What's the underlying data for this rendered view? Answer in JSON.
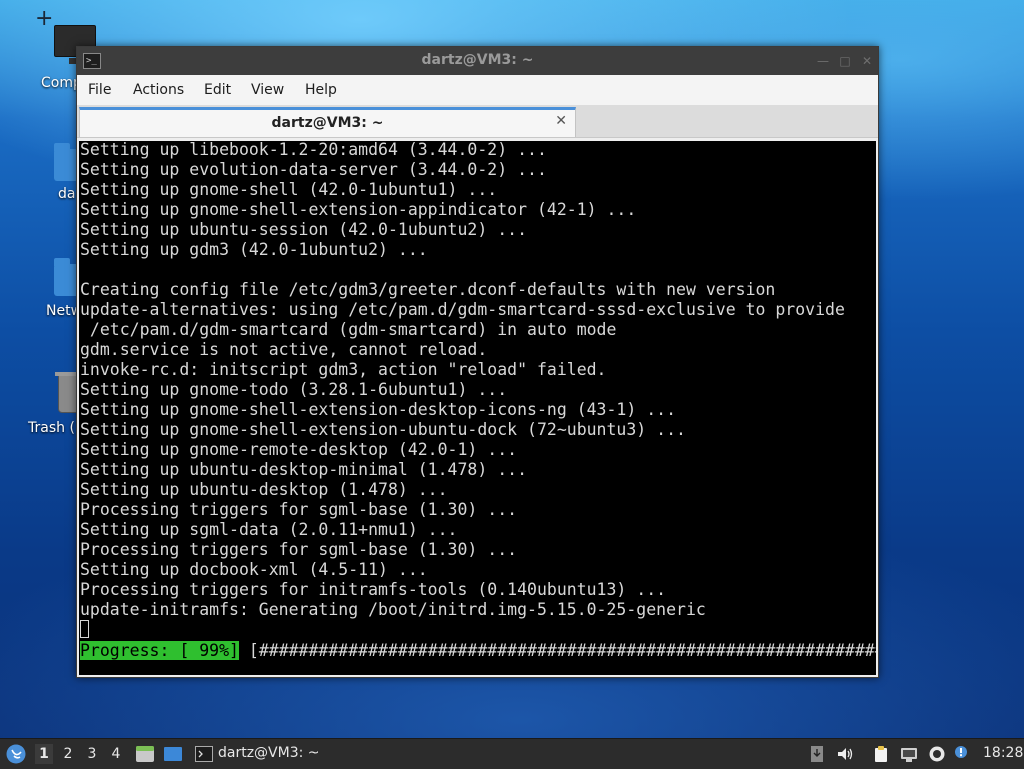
{
  "desktop": {
    "icons": [
      {
        "label": "Comp"
      },
      {
        "label": "da"
      },
      {
        "label": "Netw"
      },
      {
        "label": "Trash ("
      }
    ]
  },
  "window": {
    "title": "dartz@VM3: ~",
    "menu": [
      "File",
      "Actions",
      "Edit",
      "View",
      "Help"
    ],
    "tab_title": "dartz@VM3: ~",
    "terminal_lines": [
      "Setting up libebook-1.2-20:amd64 (3.44.0-2) ...",
      "Setting up evolution-data-server (3.44.0-2) ...",
      "Setting up gnome-shell (42.0-1ubuntu1) ...",
      "Setting up gnome-shell-extension-appindicator (42-1) ...",
      "Setting up ubuntu-session (42.0-1ubuntu2) ...",
      "Setting up gdm3 (42.0-1ubuntu2) ...",
      "",
      "Creating config file /etc/gdm3/greeter.dconf-defaults with new version",
      "update-alternatives: using /etc/pam.d/gdm-smartcard-sssd-exclusive to provide",
      " /etc/pam.d/gdm-smartcard (gdm-smartcard) in auto mode",
      "gdm.service is not active, cannot reload.",
      "invoke-rc.d: initscript gdm3, action \"reload\" failed.",
      "Setting up gnome-todo (3.28.1-6ubuntu1) ...",
      "Setting up gnome-shell-extension-desktop-icons-ng (43-1) ...",
      "Setting up gnome-shell-extension-ubuntu-dock (72~ubuntu3) ...",
      "Setting up gnome-remote-desktop (42.0-1) ...",
      "Setting up ubuntu-desktop-minimal (1.478) ...",
      "Setting up ubuntu-desktop (1.478) ...",
      "Processing triggers for sgml-base (1.30) ...",
      "Setting up sgml-data (2.0.11+nmu1) ...",
      "Processing triggers for sgml-base (1.30) ...",
      "Setting up docbook-xml (4.5-11) ...",
      "Processing triggers for initramfs-tools (0.140ubuntu13) ...",
      "update-initramfs: Generating /boot/initrd.img-5.15.0-25-generic"
    ],
    "progress_label": "Progress: [ 99%]",
    "progress_bar": " [#################################################################.]"
  },
  "taskbar": {
    "workspaces": [
      "1",
      "2",
      "3",
      "4"
    ],
    "active_workspace": "1",
    "task_label": "dartz@VM3: ~",
    "clock": "18:28"
  }
}
